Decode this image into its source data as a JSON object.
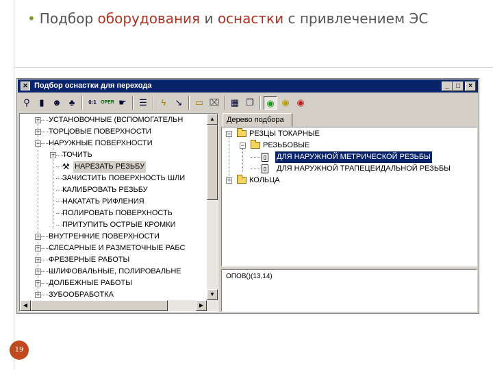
{
  "slide": {
    "title_pre": "Подбор",
    "title_accent1": "оборудования",
    "title_mid": "и",
    "title_accent2": "оснастки",
    "title_post": "с привлечением ЭС",
    "page_number": "19"
  },
  "window": {
    "title": "Подбор оснастки для перехода",
    "controls": {
      "minimize": "_",
      "maximize": "□",
      "close": "×"
    }
  },
  "toolbar": {
    "icons": [
      "tool-zoom-icon",
      "tool-book-icon",
      "tool-faces-icon",
      "tool-people-icon",
      "tool-counter-icon",
      "tool-operations-icon",
      "tool-pointer-icon",
      "tool-list-icon",
      "tool-lightning-icon",
      "tool-arrow-icon",
      "tool-folder-icon",
      "tool-trash-icon",
      "tool-database-icon",
      "tool-docs-icon",
      "tool-green-circle-icon",
      "tool-yellow-circle-icon",
      "tool-red-circle-icon"
    ],
    "counter_label": "0:1",
    "oper_label": "OPER"
  },
  "left_tree": {
    "items": [
      {
        "label": "УСТАНОВОЧНЫЕ (ВСПОМОГАТЕЛЬН",
        "level": 0,
        "expander": "+"
      },
      {
        "label": "ТОРЦОВЫЕ ПОВЕРХНОСТИ",
        "level": 0,
        "expander": "+"
      },
      {
        "label": "НАРУЖНЫЕ ПОВЕРХНОСТИ",
        "level": 0,
        "expander": "-"
      },
      {
        "label": "ТОЧИТЬ",
        "level": 1,
        "expander": "+"
      },
      {
        "label": "НАРЕЗАТЬ РЕЗЬБУ",
        "level": 1,
        "expander": "",
        "selected": true
      },
      {
        "label": "ЗАЧИСТИТЬ ПОВЕРХНОСТЬ ШЛИ",
        "level": 1,
        "expander": ""
      },
      {
        "label": "КАЛИБРОВАТЬ РЕЗЬБУ",
        "level": 1,
        "expander": ""
      },
      {
        "label": "НАКАТАТЬ РИФЛЕНИЯ",
        "level": 1,
        "expander": ""
      },
      {
        "label": "ПОЛИРОВАТЬ ПОВЕРХНОСТЬ",
        "level": 1,
        "expander": ""
      },
      {
        "label": "ПРИТУПИТЬ ОСТРЫЕ КРОМКИ",
        "level": 1,
        "expander": ""
      },
      {
        "label": "ВНУТРЕННИЕ ПОВЕРХНОСТИ",
        "level": 0,
        "expander": "+"
      },
      {
        "label": "СЛЕСАРНЫЕ И РАЗМЕТОЧНЫЕ РАБС",
        "level": 0,
        "expander": "+"
      },
      {
        "label": "ФРЕЗЕРНЫЕ РАБОТЫ",
        "level": 0,
        "expander": "+"
      },
      {
        "label": "ШЛИФОВАЛЬНЫЕ, ПОЛИРОВАЛЬНЕ",
        "level": 0,
        "expander": "+"
      },
      {
        "label": "ДОЛБЕЖНЫЕ РАБОТЫ",
        "level": 0,
        "expander": "+"
      },
      {
        "label": "ЗУБООБРАБОТКА",
        "level": 0,
        "expander": "+"
      }
    ]
  },
  "right_panel": {
    "tab_label": "Дерево подбора",
    "tree": [
      {
        "label": "РЕЗЦЫ ТОКАРНЫЕ",
        "level": 0,
        "expander": "-",
        "icon": "folder-icon"
      },
      {
        "label": "РЕЗЬБОВЫЕ",
        "level": 1,
        "expander": "-",
        "icon": "folder-icon"
      },
      {
        "label": "ДЛЯ НАРУЖНОЙ МЕТРИЧЕСКОЙ РЕЗЬБЫ",
        "level": 2,
        "expander": "",
        "icon": "document-icon",
        "selected": true
      },
      {
        "label": "ДЛЯ НАРУЖНОЙ ТРАПЕЦЕИДАЛЬНОЙ РЕЗЬБЫ",
        "level": 2,
        "expander": "",
        "icon": "document-icon"
      },
      {
        "label": "КОЛЬЦА",
        "level": 0,
        "expander": "+",
        "icon": "folder-icon"
      }
    ],
    "output_text": "ОПОВ()(13,14)"
  },
  "colors": {
    "titlebar": "#0a246a",
    "selection": "#0a246a",
    "slide_accent": "#b03020",
    "bullet": "#7a9a2e",
    "badge": "#c04a1e"
  }
}
